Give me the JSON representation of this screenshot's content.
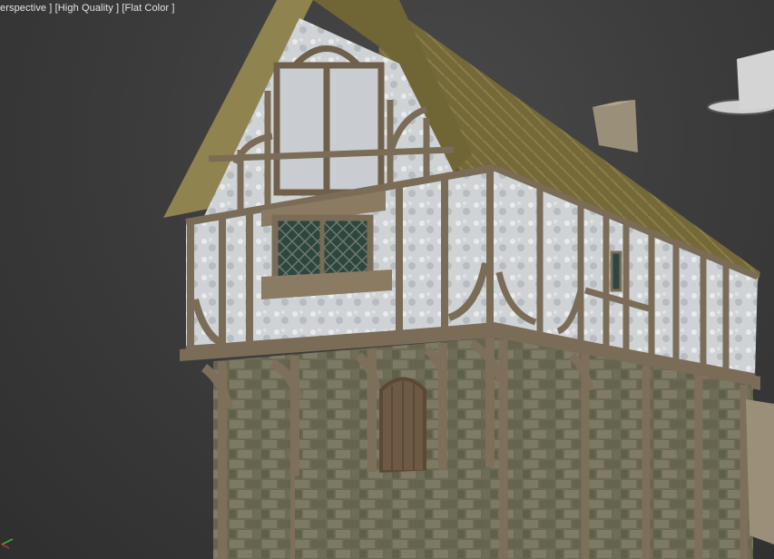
{
  "viewport": {
    "label_parts": [
      "erspective ]",
      "[High Quality ]",
      "[Flat Color ]"
    ]
  },
  "scene": {
    "object": "timber-framed-house-model",
    "colors": {
      "background": "#3b3b3b",
      "roof": "#7a6f3c",
      "timber": "#7a6c57",
      "plaster": "#d2d5d8",
      "stone": "#6b6a55",
      "window": "#2f4a44",
      "door": "#6e5a44"
    }
  },
  "gizmo": {
    "x_axis_color": "#c83232",
    "y_axis_color": "#32c832",
    "z_axis_color": "#3232c8"
  }
}
